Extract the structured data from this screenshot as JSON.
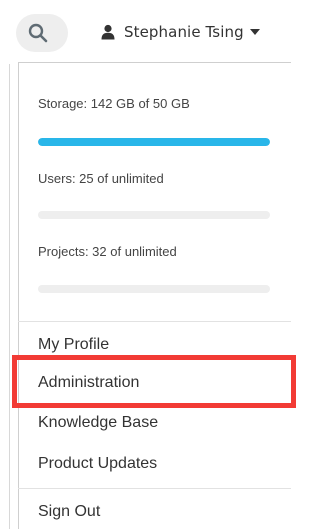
{
  "header": {
    "search_icon": "search-icon",
    "user_icon": "person-icon",
    "user_name": "Stephanie Tsing",
    "caret_icon": "caret-down-icon"
  },
  "usage": {
    "accent": "#29b6e9",
    "storage": {
      "label": "Storage: 142 GB of 50 GB",
      "fill": 1.0
    },
    "users": {
      "label": "Users: 25 of unlimited",
      "fill": 0
    },
    "projects": {
      "label": "Projects: 32 of unlimited",
      "fill": 0
    }
  },
  "menu": {
    "my_profile": "My Profile",
    "administration": "Administration",
    "knowledge_base": "Knowledge Base",
    "product_updates": "Product Updates",
    "sign_out": "Sign Out"
  },
  "highlight_color": "#f23b35"
}
